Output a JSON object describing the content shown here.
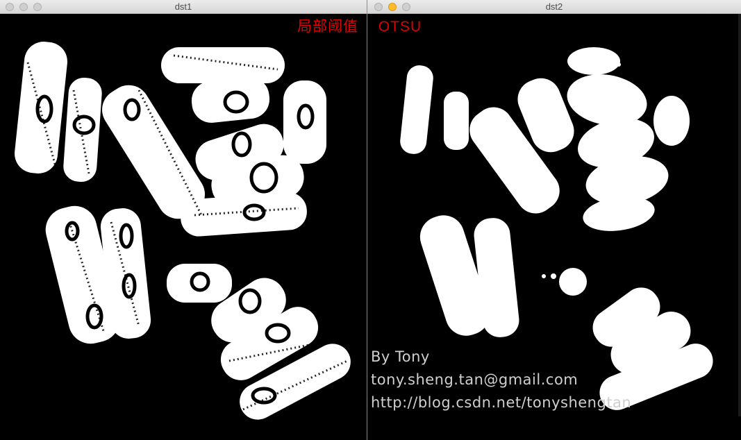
{
  "windows": [
    {
      "title": "dst1",
      "controls": [
        "close",
        "minimize",
        "zoom"
      ]
    },
    {
      "title": "dst2",
      "controls": [
        "close",
        "minimize",
        "zoom"
      ]
    }
  ],
  "overlay": {
    "left_label": "局部阈值",
    "right_label": "OTSU",
    "color": "#e00000"
  },
  "watermark": {
    "author": "By Tony",
    "email": "tony.sheng.tan@gmail.com",
    "url": "http://blog.csdn.net/tonyshengtan"
  },
  "colors": {
    "background": "#000000",
    "foreground": "#ffffff",
    "accent_button": "#fdbb2d"
  }
}
